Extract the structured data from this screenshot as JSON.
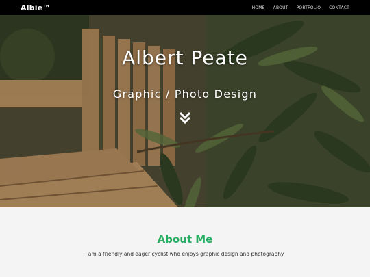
{
  "navbar": {
    "brand": "Albie™",
    "links": [
      "HOME",
      "ABOUT",
      "PORTFOLIO",
      "CONTACT"
    ]
  },
  "hero": {
    "title": "Albert Peate",
    "subtitle": "Graphic / Photo Design",
    "scroll_icon": "double-chevron-down-icon"
  },
  "about": {
    "title": "About Me",
    "text": "I am a friendly and eager cyclist who enjoys graphic design and photography."
  },
  "colors": {
    "navbar_bg": "#000000",
    "accent": "#27ae60",
    "section_bg": "#f4f4f4"
  }
}
